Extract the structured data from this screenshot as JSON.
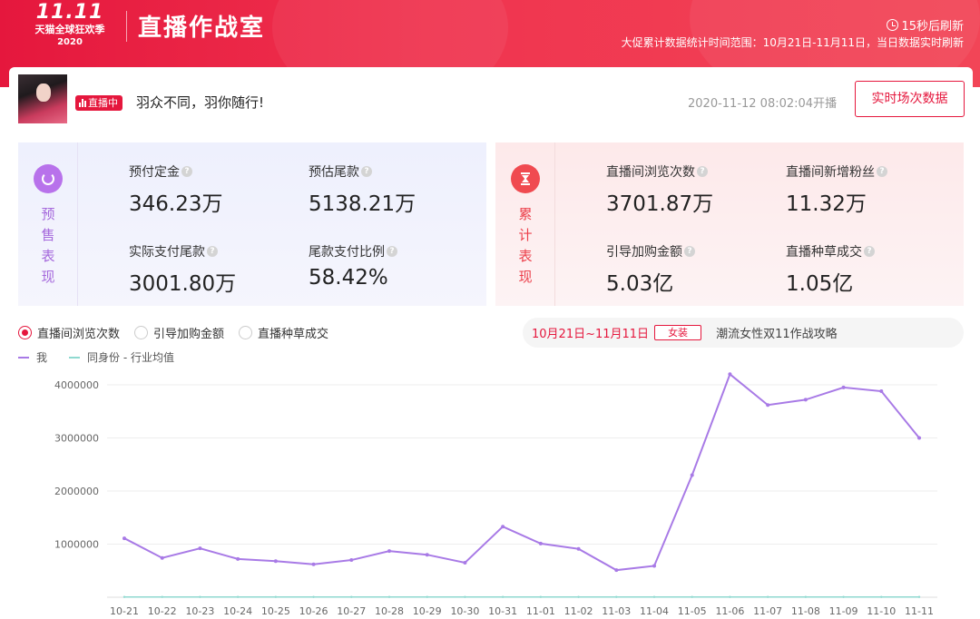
{
  "header": {
    "logo_main": "11.11",
    "logo_sub": "天猫全球狂欢季",
    "logo_year": "2020",
    "title": "直播作战室",
    "refresh": "15秒后刷新",
    "range_note": "大促累计数据统计时间范围：10月21日-11月11日，当日数据实时刷新"
  },
  "stream": {
    "live_badge": "直播中",
    "title": "羽众不同，羽你随行!",
    "start_time": "2020-11-12 08:02:04开播",
    "realtime_button": "实时场次数据"
  },
  "presale": {
    "side_label": "预售表现",
    "metrics": [
      {
        "label": "预付定金",
        "value": "346.23万"
      },
      {
        "label": "预估尾款",
        "value": "5138.21万"
      },
      {
        "label": "实际支付尾款",
        "value": "3001.80万"
      },
      {
        "label": "尾款支付比例",
        "value": "58.42%"
      }
    ]
  },
  "cumulative": {
    "side_label": "累计表现",
    "metrics": [
      {
        "label": "直播间浏览次数",
        "value": "3701.87万"
      },
      {
        "label": "直播间新增粉丝",
        "value": "11.32万"
      },
      {
        "label": "引导加购金额",
        "value": "5.03亿"
      },
      {
        "label": "直播种草成交",
        "value": "1.05亿"
      }
    ]
  },
  "chart_controls": {
    "options": [
      {
        "label": "直播间浏览次数",
        "selected": true
      },
      {
        "label": "引导加购金额",
        "selected": false
      },
      {
        "label": "直播种草成交",
        "selected": false
      }
    ],
    "promo_date": "10月21日~11月11日",
    "promo_tag": "女装",
    "promo_text": "潮流女性双11作战攻略"
  },
  "chart_data": {
    "type": "line",
    "title": "",
    "xlabel": "",
    "ylabel": "",
    "x": [
      "10-21",
      "10-22",
      "10-23",
      "10-24",
      "10-25",
      "10-26",
      "10-27",
      "10-28",
      "10-29",
      "10-30",
      "10-31",
      "11-01",
      "11-02",
      "11-03",
      "11-04",
      "11-05",
      "11-06",
      "11-07",
      "11-08",
      "11-09",
      "11-10",
      "11-11"
    ],
    "yticks": [
      "1000000",
      "2000000",
      "3000000",
      "4000000"
    ],
    "ylim": [
      0,
      4500000
    ],
    "grid": true,
    "legend_position": "top-left",
    "series": [
      {
        "name": "我",
        "color": "#a87ae6",
        "values": [
          1110000,
          740000,
          920000,
          720000,
          680000,
          620000,
          700000,
          870000,
          800000,
          650000,
          1330000,
          1010000,
          910000,
          510000,
          590000,
          2300000,
          4200000,
          3620000,
          3720000,
          3950000,
          3880000,
          3000000
        ]
      },
      {
        "name": "同身份 - 行业均值",
        "color": "#8fd9d0",
        "values": [
          5000,
          5000,
          5000,
          5000,
          5000,
          5000,
          5000,
          5000,
          5000,
          5000,
          5000,
          5000,
          5000,
          5000,
          5000,
          5000,
          5000,
          5000,
          5000,
          5000,
          5000,
          5000
        ]
      }
    ]
  }
}
